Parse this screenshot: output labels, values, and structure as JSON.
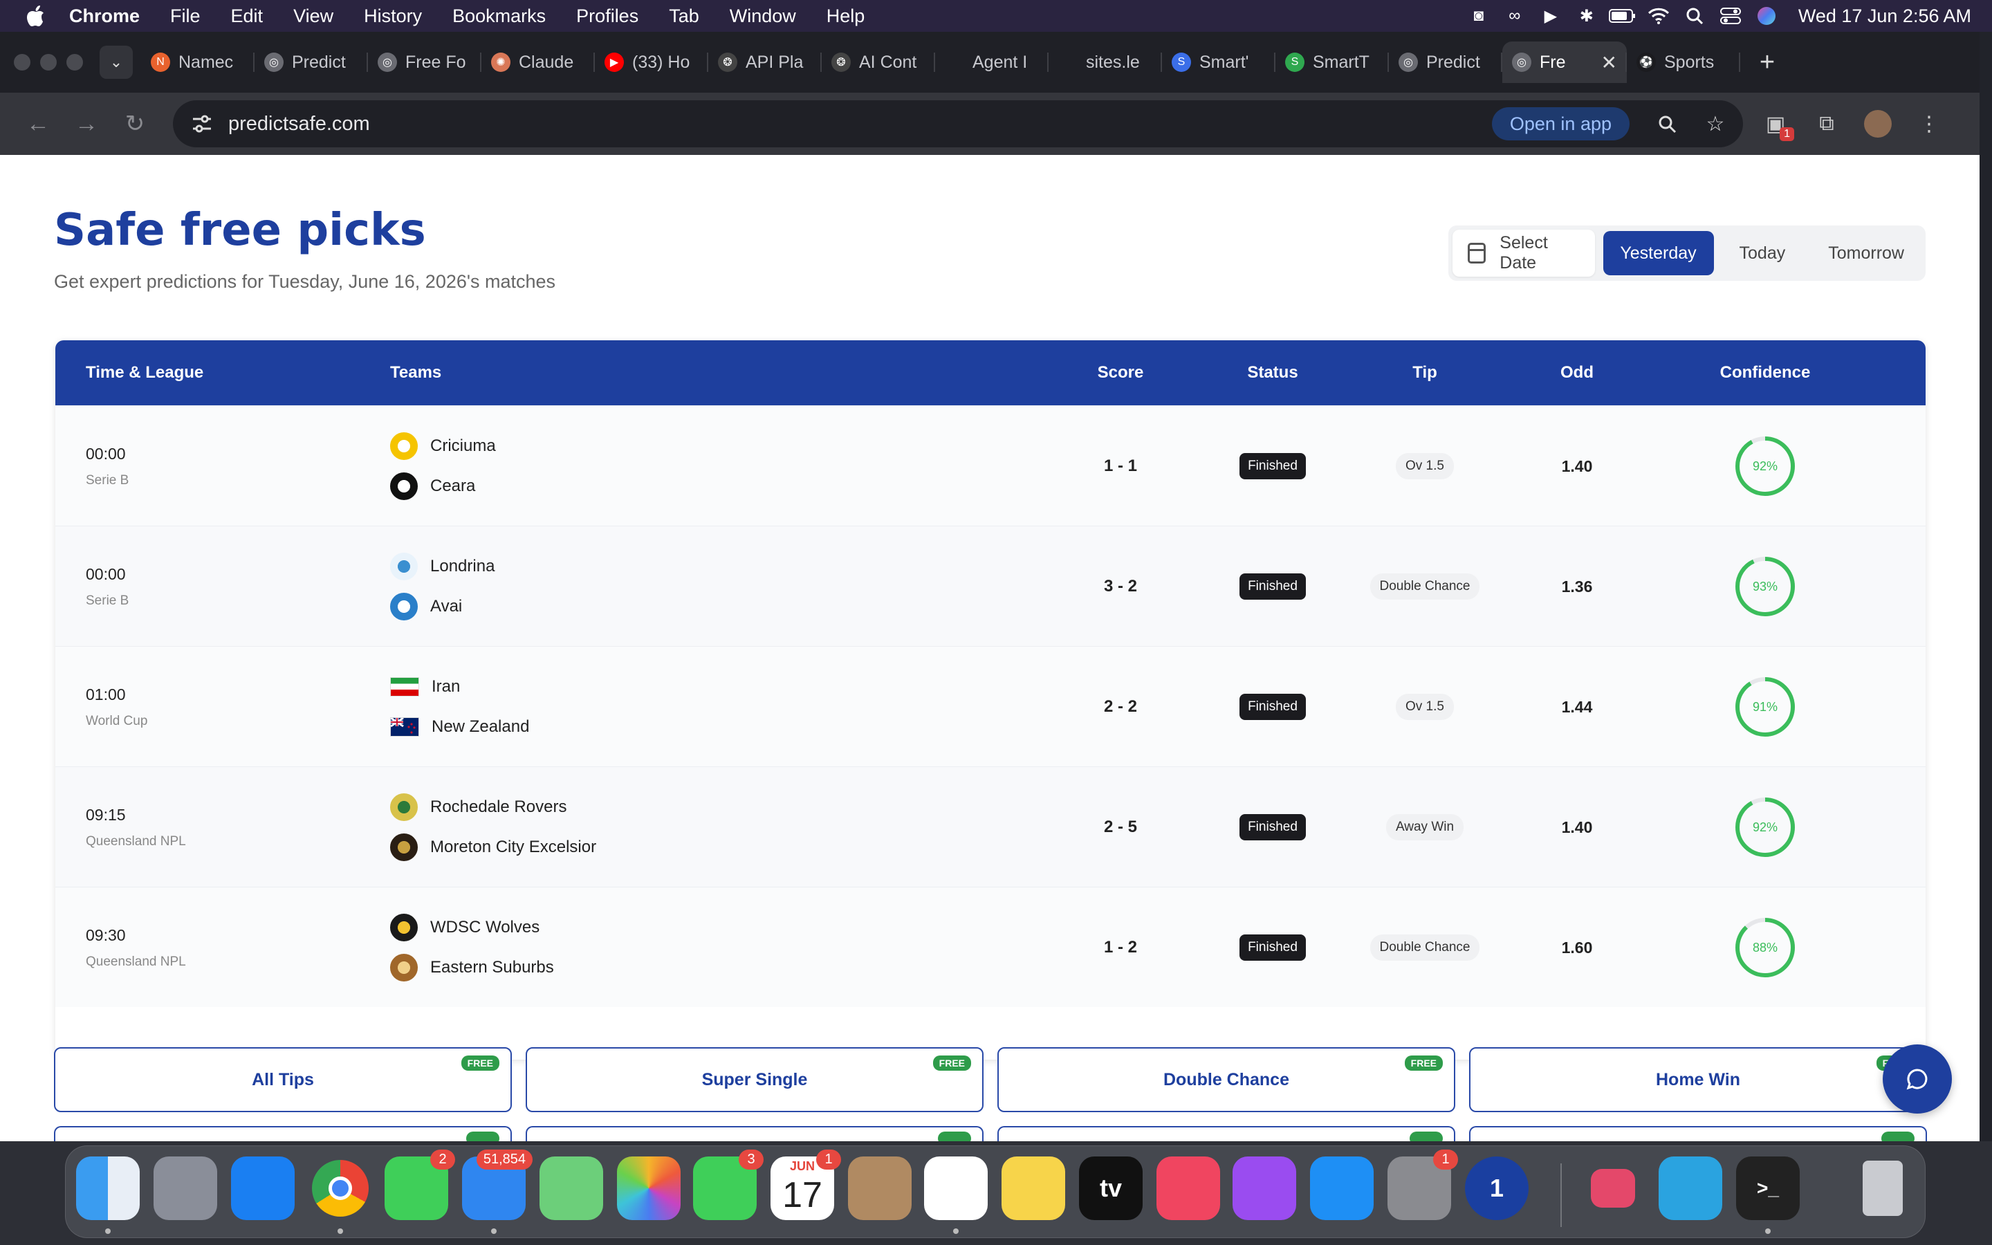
{
  "menubar": {
    "app": "Chrome",
    "items": [
      "File",
      "Edit",
      "View",
      "History",
      "Bookmarks",
      "Profiles",
      "Tab",
      "Window",
      "Help"
    ],
    "clock": "Wed 17 Jun  2:56 AM"
  },
  "tabs": [
    {
      "label": "Namec",
      "icon": "N",
      "color": "#e8622e"
    },
    {
      "label": "Predict",
      "icon": "globe",
      "color": "#6a6b72"
    },
    {
      "label": "Free Fo",
      "icon": "globe",
      "color": "#6a6b72"
    },
    {
      "label": "Claude",
      "icon": "claude",
      "color": "#d97757"
    },
    {
      "label": "(33) Ho",
      "icon": "youtube",
      "color": "#ff0000"
    },
    {
      "label": "API Pla",
      "icon": "openai",
      "color": "#444"
    },
    {
      "label": "AI Cont",
      "icon": "openai",
      "color": "#444"
    },
    {
      "label": "Agent I",
      "icon": "none",
      "color": "transparent"
    },
    {
      "label": "sites.le",
      "icon": "none",
      "color": "transparent"
    },
    {
      "label": "Smart'",
      "icon": "S",
      "color": "#3b6ee8"
    },
    {
      "label": "SmartT",
      "icon": "S",
      "color": "#2fa84f"
    },
    {
      "label": "Predict",
      "icon": "globe",
      "color": "#6a6b72"
    }
  ],
  "active_tab": {
    "label": "Fre"
  },
  "last_tab": {
    "label": "Sports",
    "icon": "S"
  },
  "toolbar": {
    "url": "predictsafe.com",
    "open_in_app": "Open in app",
    "ext_badge": "1"
  },
  "page": {
    "title": "Safe free picks",
    "subtitle": "Get expert predictions for Tuesday, June 16, 2026's matches",
    "date_select": "Select Date",
    "date_options": [
      "Yesterday",
      "Today",
      "Tomorrow"
    ],
    "selected_date": "Yesterday"
  },
  "table": {
    "headers": {
      "time": "Time & League",
      "teams": "Teams",
      "score": "Score",
      "status": "Status",
      "tip": "Tip",
      "odd": "Odd",
      "confidence": "Confidence"
    },
    "rows": [
      {
        "time": "00:00",
        "league": "Serie B",
        "home": "Criciuma",
        "away": "Ceara",
        "score": "1 - 1",
        "status": "Finished",
        "tip": "Ov 1.5",
        "odd": "1.40",
        "confidence": "92%",
        "conf_value": 0.92,
        "home_logo": "criciuma",
        "away_logo": "ceara"
      },
      {
        "time": "00:00",
        "league": "Serie B",
        "home": "Londrina",
        "away": "Avai",
        "score": "3 - 2",
        "status": "Finished",
        "tip": "Double Chance",
        "odd": "1.36",
        "confidence": "93%",
        "conf_value": 0.93,
        "home_logo": "londrina",
        "away_logo": "avai"
      },
      {
        "time": "01:00",
        "league": "World Cup",
        "home": "Iran",
        "away": "New Zealand",
        "score": "2 - 2",
        "status": "Finished",
        "tip": "Ov 1.5",
        "odd": "1.44",
        "confidence": "91%",
        "conf_value": 0.91,
        "home_logo": "flag-iran",
        "away_logo": "flag-nz"
      },
      {
        "time": "09:15",
        "league": "Queensland NPL",
        "home": "Rochedale Rovers",
        "away": "Moreton City Excelsior",
        "score": "2 - 5",
        "status": "Finished",
        "tip": "Away Win",
        "odd": "1.40",
        "confidence": "92%",
        "conf_value": 0.92,
        "home_logo": "rochedale",
        "away_logo": "moreton"
      },
      {
        "time": "09:30",
        "league": "Queensland NPL",
        "home": "WDSC Wolves",
        "away": "Eastern Suburbs",
        "score": "1 - 2",
        "status": "Finished",
        "tip": "Double Chance",
        "odd": "1.60",
        "confidence": "88%",
        "conf_value": 0.88,
        "home_logo": "wolves",
        "away_logo": "suburbs"
      }
    ]
  },
  "categories": [
    {
      "label": "All Tips",
      "badge": "FREE"
    },
    {
      "label": "Super Single",
      "badge": "FREE"
    },
    {
      "label": "Double Chance",
      "badge": "FREE"
    },
    {
      "label": "Home Win",
      "badge": "FREE"
    }
  ],
  "colors": {
    "brand": "#1e3f9e",
    "confidence": "#3bbd5b",
    "free_badge": "#2e9c4a"
  },
  "dock": [
    {
      "name": "finder"
    },
    {
      "name": "launchpad"
    },
    {
      "name": "safari"
    },
    {
      "name": "chrome"
    },
    {
      "name": "messages",
      "badge": "2"
    },
    {
      "name": "mail",
      "badge": "51,854"
    },
    {
      "name": "maps"
    },
    {
      "name": "photos"
    },
    {
      "name": "facetime",
      "badge": "3"
    },
    {
      "name": "calendar",
      "badge": "1",
      "month": "JUN",
      "day": "17"
    },
    {
      "name": "contacts"
    },
    {
      "name": "reminders"
    },
    {
      "name": "notes"
    },
    {
      "name": "apple-tv",
      "label": "tv"
    },
    {
      "name": "music"
    },
    {
      "name": "podcasts"
    },
    {
      "name": "app-store"
    },
    {
      "name": "system-settings",
      "badge": "1"
    },
    {
      "name": "1password",
      "label": "1"
    },
    {
      "name": "bot-app"
    },
    {
      "name": "telegram"
    },
    {
      "name": "terminal",
      "label": ">_"
    },
    {
      "name": "trash"
    }
  ]
}
